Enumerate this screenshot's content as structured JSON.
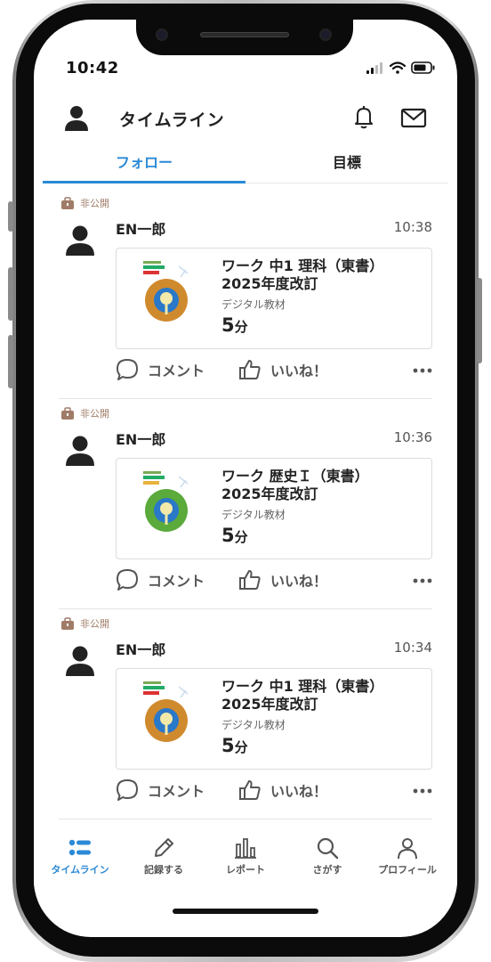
{
  "status_bar": {
    "time": "10:42",
    "icons": [
      "signal-icon",
      "wifi-icon",
      "battery-icon"
    ]
  },
  "header": {
    "title": "タイムライン",
    "icons": [
      "user-icon",
      "bell-icon",
      "mail-icon"
    ]
  },
  "tabs": [
    {
      "label": "フォロー",
      "active": true
    },
    {
      "label": "目標",
      "active": false
    }
  ],
  "posts": [
    {
      "privacy": "非公開",
      "user_name": "EN一郎",
      "time": "10:38",
      "book_title_line1": "ワーク 中1 理科（東書）",
      "book_title_line2": "2025年度改訂",
      "book_type": "デジタル教材",
      "duration_value": "5",
      "duration_unit": "分",
      "cover_color": "#d08a2e",
      "comment_label": "コメント",
      "like_label": "いいね！"
    },
    {
      "privacy": "非公開",
      "user_name": "EN一郎",
      "time": "10:36",
      "book_title_line1": "ワーク 歴史Ｉ（東書）",
      "book_title_line2": "2025年度改訂",
      "book_type": "デジタル教材",
      "duration_value": "5",
      "duration_unit": "分",
      "cover_color": "#5aaa3c",
      "comment_label": "コメント",
      "like_label": "いいね！"
    },
    {
      "privacy": "非公開",
      "user_name": "EN一郎",
      "time": "10:34",
      "book_title_line1": "ワーク 中1 理科（東書）",
      "book_title_line2": "2025年度改訂",
      "book_type": "デジタル教材",
      "duration_value": "5",
      "duration_unit": "分",
      "cover_color": "#d08a2e",
      "comment_label": "コメント",
      "like_label": "いいね！"
    }
  ],
  "bottom_nav": [
    {
      "label": "タイムライン",
      "icon": "list-icon",
      "active": true
    },
    {
      "label": "記録する",
      "icon": "pencil-icon",
      "active": false
    },
    {
      "label": "レポート",
      "icon": "bar-chart-icon",
      "active": false
    },
    {
      "label": "さがす",
      "icon": "search-icon",
      "active": false
    },
    {
      "label": "プロフィール",
      "icon": "profile-icon",
      "active": false
    }
  ],
  "colors": {
    "accent": "#2b8ad6",
    "privacy": "#a07c68",
    "divider": "#e4e4e4"
  }
}
